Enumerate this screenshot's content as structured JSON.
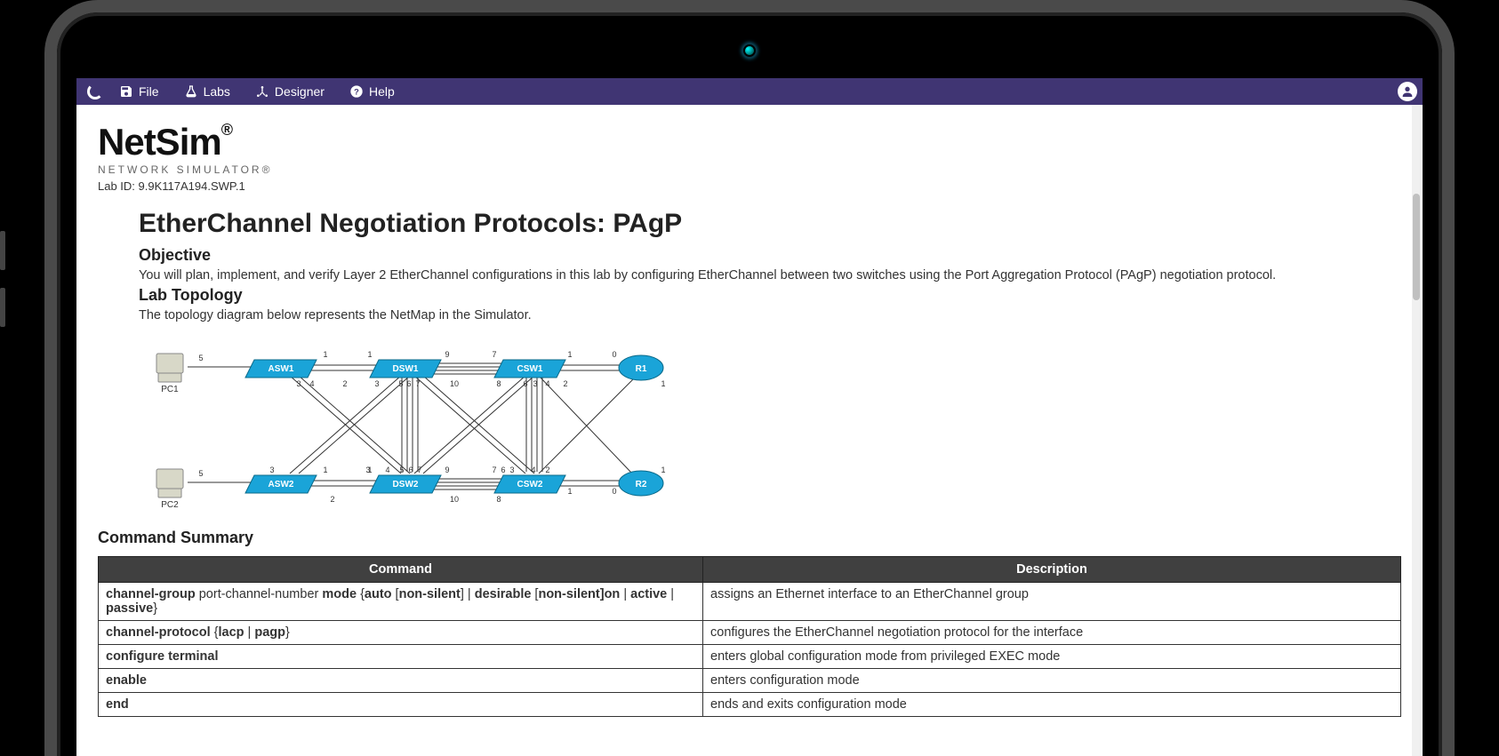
{
  "menubar": {
    "file": "File",
    "labs": "Labs",
    "designer": "Designer",
    "help": "Help"
  },
  "logo": {
    "main": "NetSim",
    "sub": "NETWORK SIMULATOR",
    "reg": "®"
  },
  "lab_id_label": "Lab ID: ",
  "lab_id": "9.9K117A194.SWP.1",
  "title": "EtherChannel Negotiation Protocols: PAgP",
  "objective_h": "Objective",
  "objective_text": "You will plan, implement, and verify Layer 2 EtherChannel configurations in this lab by configuring EtherChannel between two switches using the Port Aggregation Protocol (PAgP) negotiation protocol.",
  "topology_h": "Lab Topology",
  "topology_text": "The topology diagram below represents the NetMap in the Simulator.",
  "topology_nodes": {
    "pc1": "PC1",
    "pc2": "PC2",
    "asw1": "ASW1",
    "asw2": "ASW2",
    "dsw1": "DSW1",
    "dsw2": "DSW2",
    "csw1": "CSW1",
    "csw2": "CSW2",
    "r1": "R1",
    "r2": "R2"
  },
  "cmdsummary_h": "Command Summary",
  "table_headers": {
    "command": "Command",
    "description": "Description"
  },
  "commands": [
    {
      "cmd_html": "<b>channel-group</b> port-channel-number <b>mode</b> {<b>auto</b> [<b>non-silent</b>] | <b>desirable</b> [<b>non-silent]on</b> | <b>active</b> | <b>passive</b>}",
      "desc": "assigns an Ethernet interface to an EtherChannel group"
    },
    {
      "cmd_html": "<b>channel-protocol</b> {<b>lacp</b> | <b>pagp</b>}",
      "desc": "configures the EtherChannel negotiation protocol for the interface"
    },
    {
      "cmd_html": "<b>configure terminal</b>",
      "desc": "enters global configuration mode from privileged EXEC mode"
    },
    {
      "cmd_html": "<b>enable</b>",
      "desc": "enters configuration mode"
    },
    {
      "cmd_html": "<b>end</b>",
      "desc": "ends and exits configuration mode"
    }
  ]
}
